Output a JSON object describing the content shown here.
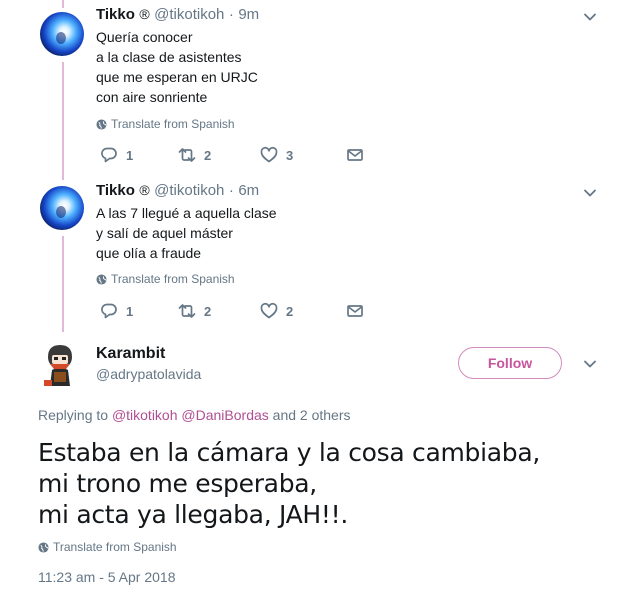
{
  "tweets": [
    {
      "name": "Tikko",
      "badge": "®",
      "handle": "@tikotikoh",
      "sep": "·",
      "time": "9m",
      "text": "Quería conocer\na la clase de asistentes\nque me esperan en URJC\ncon aire sonriente",
      "translate": "Translate from Spanish",
      "replies": "1",
      "retweets": "2",
      "likes": "3"
    },
    {
      "name": "Tikko",
      "badge": "®",
      "handle": "@tikotikoh",
      "sep": "·",
      "time": "6m",
      "text": "A las 7 llegué a aquella clase\ny salí de aquel máster\nque olía a fraude",
      "translate": "Translate from Spanish",
      "replies": "1",
      "retweets": "2",
      "likes": "2"
    }
  ],
  "main_tweet": {
    "name": "Karambit",
    "handle": "@adrypatolavida",
    "follow_label": "Follow",
    "replying_prefix": "Replying to",
    "mention_1": "@tikotikoh",
    "mention_2": "@DaniBordas",
    "replying_suffix": "and 2 others",
    "text": "Estaba en la cámara y la cosa cambiaba,\nmi trono me esperaba,\nmi acta ya llegaba, JAH!!.",
    "translate": "Translate from Spanish",
    "timestamp": "11:23 am - 5 Apr 2018"
  },
  "icons": {
    "reply": "reply-icon",
    "retweet": "retweet-icon",
    "like": "heart-icon",
    "dm": "envelope-icon",
    "globe": "globe-icon",
    "menu": "chevron-down-icon"
  },
  "colors": {
    "accent": "#c5569e",
    "thread_line": "#e1b8d6",
    "secondary_text": "#657786"
  }
}
